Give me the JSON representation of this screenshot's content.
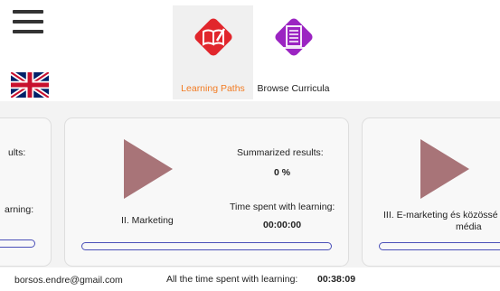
{
  "nav": {
    "learning_paths_label": "Learning Paths",
    "browse_curricula_label": "Browse Curricula"
  },
  "colors": {
    "learning_paths_icon": "#e1262c",
    "browse_curricula_icon": "#9b24c2",
    "active_label": "#f27b22",
    "progress_border": "#4a4fb8",
    "play_button": "#a87478"
  },
  "cards": [
    {
      "results_label": "ults:",
      "learning_label": "arning:",
      "progress": 0
    },
    {
      "title": "II. Marketing",
      "results_label": "Summarized results:",
      "results_value": "0 %",
      "time_label": "Time spent with learning:",
      "time_value": "00:00:00",
      "progress": 0
    },
    {
      "title_line1": "III. E-marketing és közössé",
      "title_line2": "média",
      "progress": 0
    }
  ],
  "footer": {
    "email": "borsos.endre@gmail.com",
    "total_time_label": "All the time spent with learning:",
    "total_time_value": "00:38:09"
  }
}
